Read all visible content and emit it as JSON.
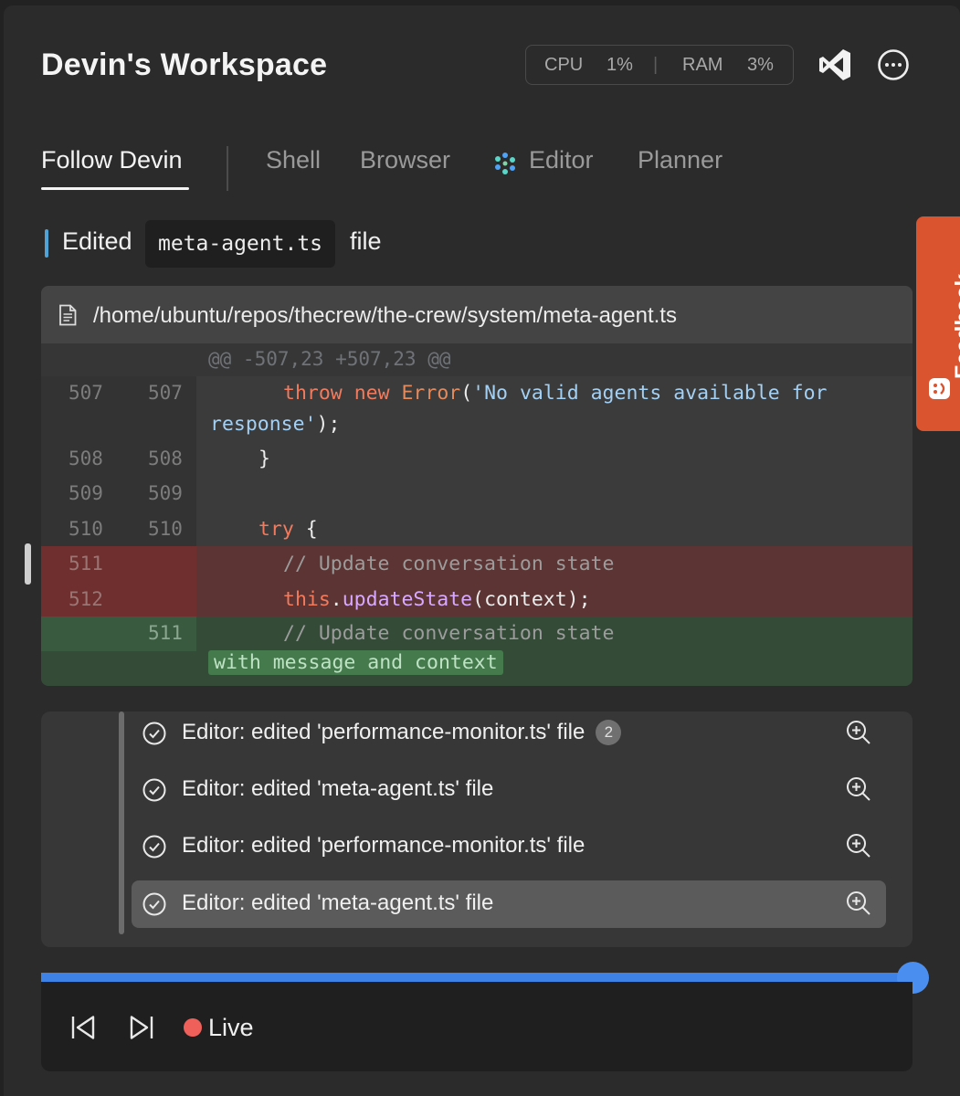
{
  "window": {
    "title": "Devin's Workspace"
  },
  "metrics": {
    "cpu_label": "CPU",
    "cpu_value": "1%",
    "separator": "|",
    "ram_label": "RAM",
    "ram_value": "3%"
  },
  "tabs": [
    {
      "label": "Follow Devin",
      "active": true
    },
    {
      "label": "Shell"
    },
    {
      "label": "Browser"
    },
    {
      "label": "Editor",
      "icon": "editor-logo-icon"
    },
    {
      "label": "Planner"
    }
  ],
  "edit_event": {
    "prefix": "Edited",
    "file": "meta-agent.ts",
    "suffix": "file"
  },
  "diff": {
    "path": "/home/ubuntu/repos/thecrew/the-crew/system/meta-agent.ts",
    "hunk": "@@ -507,23 +507,23 @@",
    "lines": [
      {
        "old": "507",
        "new": "507",
        "kind": "context",
        "kw1": "throw",
        "kw2": "new",
        "cls": "Error",
        "open": "(",
        "str": "'No valid agents available for",
        "cont_str": "response'",
        "close": ");"
      },
      {
        "old": "508",
        "new": "508",
        "kind": "context",
        "text": "}"
      },
      {
        "old": "509",
        "new": "509",
        "kind": "context",
        "text": ""
      },
      {
        "old": "510",
        "new": "510",
        "kind": "context",
        "kw": "try",
        "text": " {"
      },
      {
        "old": "511",
        "new": "",
        "kind": "deleted",
        "comment": "// Update conversation state"
      },
      {
        "old": "512",
        "new": "",
        "kind": "deleted",
        "this": "this",
        "dot": ".",
        "fn": "updateState",
        "args": "(context);"
      },
      {
        "old": "",
        "new": "511",
        "kind": "added",
        "comment": "// Update conversation state",
        "cont": "with message and context"
      }
    ]
  },
  "activity": [
    {
      "label": "Editor: edited 'performance-monitor.ts' file",
      "badge": "2",
      "selected": false
    },
    {
      "label": "Editor: edited 'meta-agent.ts' file",
      "selected": false
    },
    {
      "label": "Editor: edited 'performance-monitor.ts' file",
      "selected": false
    },
    {
      "label": "Editor: edited 'meta-agent.ts' file",
      "selected": true
    }
  ],
  "playback": {
    "progress": 1.0,
    "status": "Live"
  },
  "feedback": {
    "label": "Feedback"
  },
  "colors": {
    "accent": "#3f82e6",
    "live": "#f0605b",
    "feedback": "#d9542f",
    "deleted": "#6e2f2e",
    "added": "#3a5a40"
  }
}
